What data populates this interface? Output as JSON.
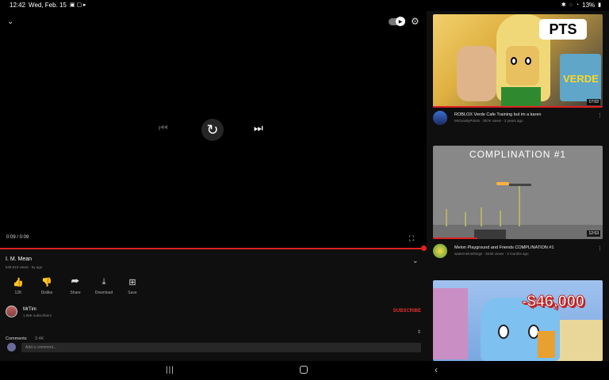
{
  "status_bar": {
    "time": "12:42",
    "date": "Wed, Feb. 15",
    "battery": "13%"
  },
  "player": {
    "timecode": "0:09 / 0:09",
    "progress_fraction": 1.0
  },
  "video": {
    "title": "I. M. Mean",
    "meta": "548,510 views · 6y ago"
  },
  "actions": [
    {
      "icon": "thumbs-up-icon",
      "glyph": "👍",
      "label": "12K"
    },
    {
      "icon": "thumbs-down-icon",
      "glyph": "👎",
      "label": "Dislike"
    },
    {
      "icon": "share-icon",
      "glyph": "⮫",
      "label": "Share"
    },
    {
      "icon": "download-icon",
      "glyph": "⤓",
      "label": "Download"
    },
    {
      "icon": "save-icon",
      "glyph": "⊞",
      "label": "Save"
    }
  ],
  "channel": {
    "name": "MrTim",
    "subscribers": "1.96K subscribers",
    "subscribe_label": "SUBSCRIBE"
  },
  "comments": {
    "label": "Comments",
    "count": "3.4K",
    "placeholder": "Add a comment..."
  },
  "feed": [
    {
      "title": "ROBLOX Verde Cafe Training but im a karen",
      "channel_meta": "MrGravityPoints · 357K views · 2 years ago",
      "duration": "17:02",
      "thumb_text": "PTS",
      "thumb_text_2": "VERDE"
    },
    {
      "title": "Melon Playground and Friends COMPLINATION #1",
      "channel_meta": "watermelonthings · 823K views · 3 months ago",
      "duration": "12:53",
      "thumb_text": "COMPLINATION #1"
    },
    {
      "title": "",
      "channel_meta": "",
      "duration": "",
      "thumb_text": "-$46,000"
    }
  ],
  "colors": {
    "accent": "#e02020",
    "background": "#0f0f0f"
  }
}
